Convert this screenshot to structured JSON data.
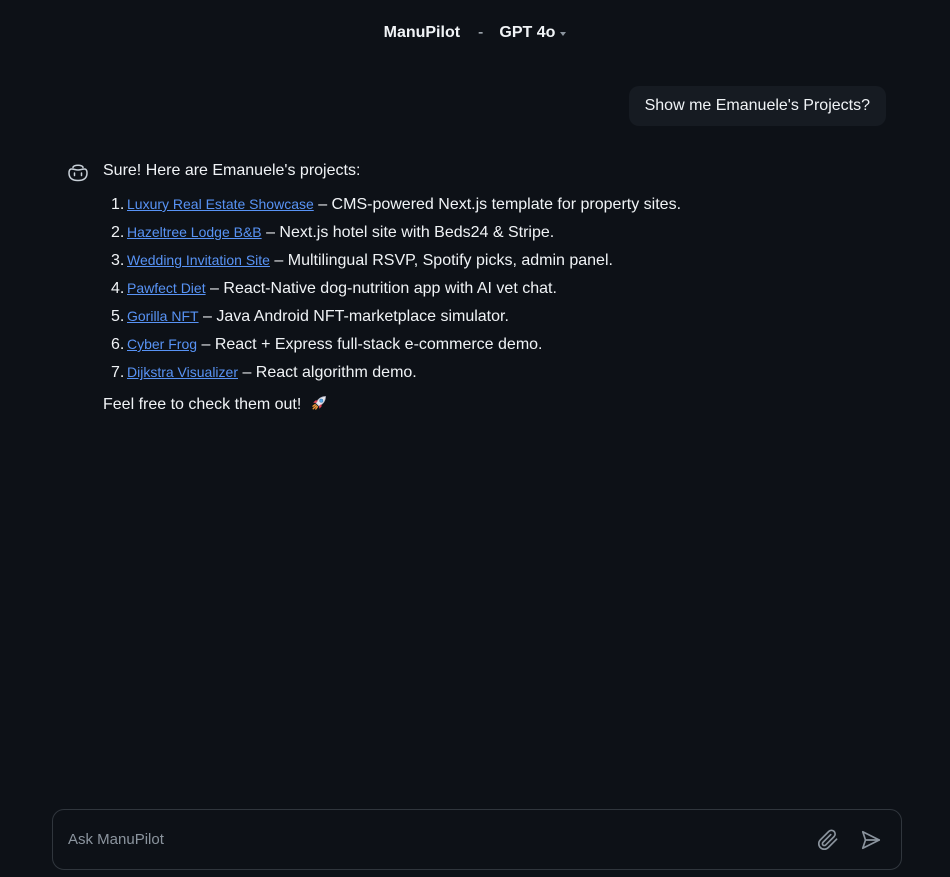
{
  "header": {
    "app_name": "ManuPilot",
    "separator": "-",
    "model": "GPT 4o"
  },
  "conversation": {
    "user_message": "Show me Emanuele's Projects?",
    "assistant": {
      "intro": "Sure! Here are Emanuele's projects:",
      "projects": [
        {
          "number": "1.",
          "name": "Luxury Real Estate Showcase",
          "description": " – CMS-powered Next.js template for property sites."
        },
        {
          "number": "2.",
          "name": "Hazeltree Lodge B&B",
          "description": " – Next.js hotel site with Beds24 & Stripe."
        },
        {
          "number": "3.",
          "name": "Wedding Invitation Site",
          "description": " – Multilingual RSVP, Spotify picks, admin panel."
        },
        {
          "number": "4.",
          "name": "Pawfect Diet",
          "description": " – React-Native dog-nutrition app with AI vet chat."
        },
        {
          "number": "5.",
          "name": "Gorilla NFT",
          "description": " – Java Android NFT-marketplace simulator."
        },
        {
          "number": "6.",
          "name": "Cyber Frog",
          "description": " – React + Express full-stack e-commerce demo."
        },
        {
          "number": "7.",
          "name": "Dijkstra Visualizer",
          "description": " – React algorithm demo."
        }
      ],
      "outro": "Feel free to check them out!",
      "outro_icon": "rocket-icon"
    }
  },
  "composer": {
    "placeholder": "Ask ManuPilot",
    "value": "",
    "attach_icon": "paperclip-icon",
    "send_icon": "send-icon"
  },
  "colors": {
    "background": "#0d1117",
    "bubble": "#161b22",
    "link": "#5893f5",
    "text": "#f0f3f6",
    "muted": "#8b949e",
    "border": "#30363d"
  }
}
